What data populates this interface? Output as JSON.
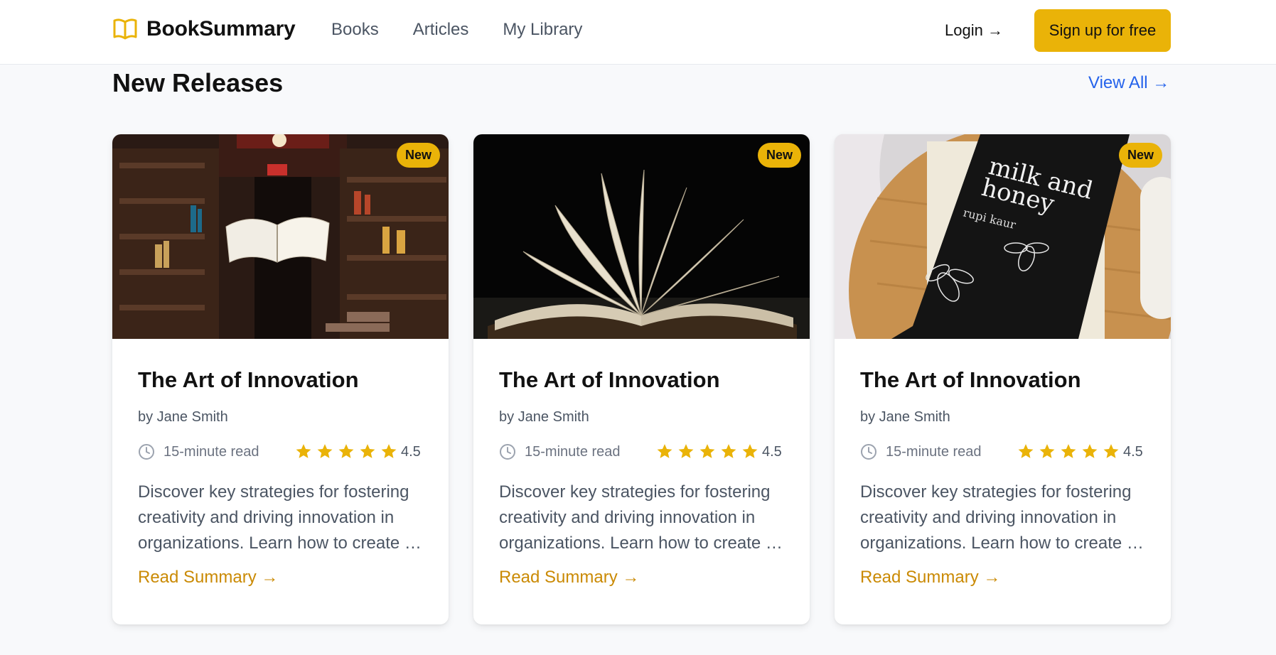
{
  "header": {
    "brand": "BookSummary",
    "nav": [
      "Books",
      "Articles",
      "My Library"
    ],
    "login": "Login →",
    "signup": "Sign up for free"
  },
  "section": {
    "title": "New Releases",
    "view_all": "View All →"
  },
  "colors": {
    "accent": "#eab308",
    "link": "#2563eb",
    "read_link": "#ca8a04"
  },
  "cards": [
    {
      "badge": "New",
      "image": "library-floating-book",
      "title": "The Art of Innovation",
      "author": "by Jane Smith",
      "read_time": "15-minute read",
      "rating": "4.5",
      "stars": 5,
      "description": "Discover key strategies for fostering creativity and driving innovation in organizations. Learn how to create a culture of innovation.",
      "link": "Read Summary →"
    },
    {
      "badge": "New",
      "image": "open-book-dark",
      "title": "The Art of Innovation",
      "author": "by Jane Smith",
      "read_time": "15-minute read",
      "rating": "4.5",
      "stars": 5,
      "description": "Discover key strategies for fostering creativity and driving innovation in organizations. Learn how to create a culture of innovation.",
      "link": "Read Summary →"
    },
    {
      "badge": "New",
      "image": "milk-and-honey-book",
      "title": "The Art of Innovation",
      "author": "by Jane Smith",
      "read_time": "15-minute read",
      "rating": "4.5",
      "stars": 5,
      "description": "Discover key strategies for fostering creativity and driving innovation in organizations. Learn how to create a culture of innovation.",
      "link": "Read Summary →"
    }
  ],
  "cover_text": {
    "title_line1": "milk and",
    "title_line2": "honey",
    "author": "rupi kaur"
  }
}
